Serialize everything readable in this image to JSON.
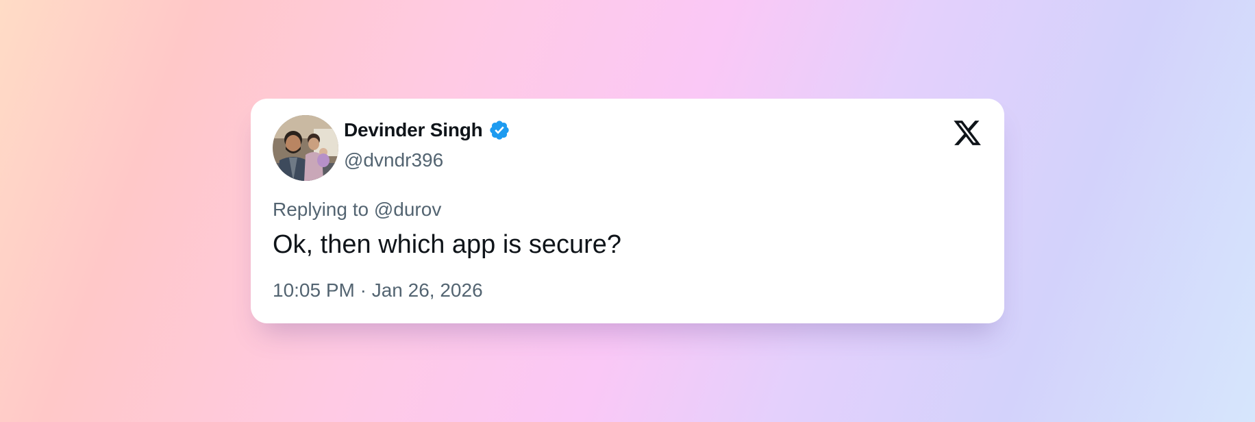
{
  "tweet": {
    "author_name": "Devinder Singh",
    "author_handle": "@dvndr396",
    "verified": true,
    "reply_prefix": "Replying to",
    "reply_to_handle": "@durov",
    "reply_line": "Replying to @durov",
    "text": "Ok, then which app is secure?",
    "time": "10:05 PM",
    "date": "Jan 26, 2026",
    "timestamp_line": "10:05 PM · Jan 26, 2026"
  },
  "icons": {
    "brand": "x-logo-icon",
    "verified": "verified-badge-icon",
    "avatar": "profile-photo"
  },
  "colors": {
    "verified_blue": "#1d9bf0",
    "primary_text": "#0f1419",
    "secondary_text": "#536471",
    "card_background": "#ffffff"
  }
}
